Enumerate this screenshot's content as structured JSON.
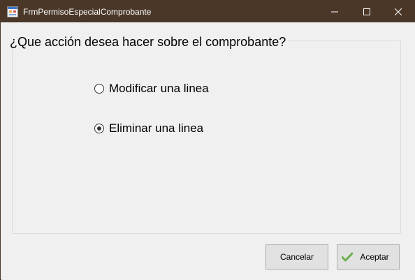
{
  "window": {
    "title": "FrmPermisoEspecialComprobante",
    "titlebar_color": "#4a3728"
  },
  "group": {
    "legend": "¿Que acción desea hacer sobre el comprobante?"
  },
  "options": [
    {
      "label": "Modificar una linea",
      "checked": false
    },
    {
      "label": "Eliminar una linea",
      "checked": true
    }
  ],
  "buttons": {
    "cancel_label": "Cancelar",
    "accept_label": "Aceptar",
    "accept_icon": "checkmark-icon",
    "accept_icon_color": "#6ab04c"
  },
  "titlebar_controls": [
    "minimize-icon",
    "maximize-icon",
    "close-icon"
  ]
}
